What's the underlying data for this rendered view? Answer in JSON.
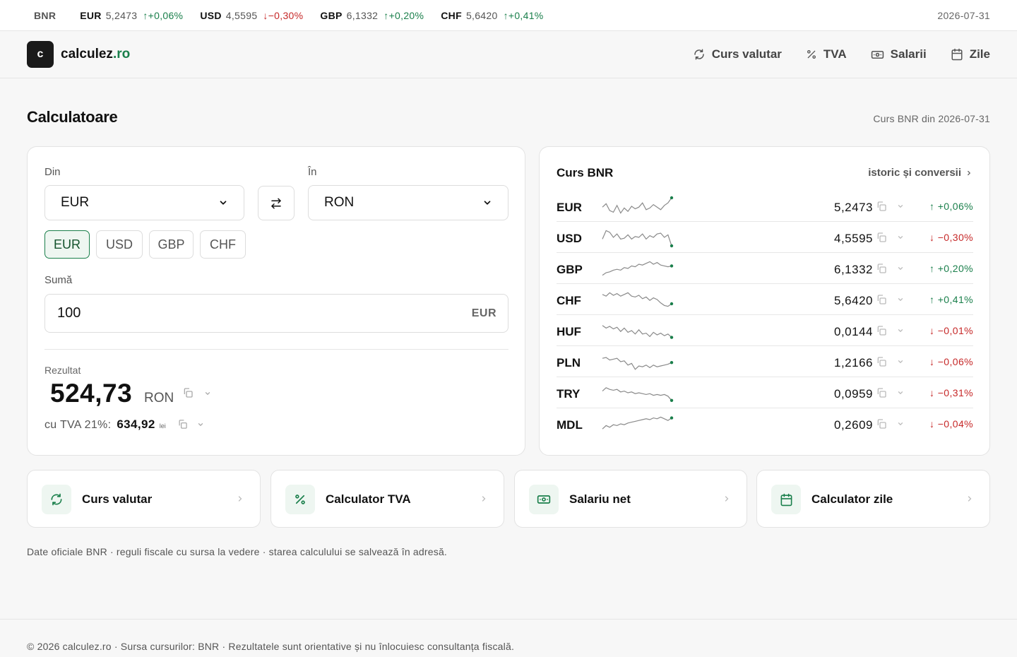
{
  "ticker": {
    "source": "BNR",
    "items": [
      {
        "code": "EUR",
        "value": "5,2473",
        "change": "↑+0,06%",
        "dir": "up"
      },
      {
        "code": "USD",
        "value": "4,5595",
        "change": "↓−0,30%",
        "dir": "down"
      },
      {
        "code": "GBP",
        "value": "6,1332",
        "change": "↑+0,20%",
        "dir": "up"
      },
      {
        "code": "CHF",
        "value": "5,6420",
        "change": "↑+0,41%",
        "dir": "up"
      }
    ],
    "date": "2026-07-31"
  },
  "header": {
    "logo_letter": "c",
    "logo_name": "calculez",
    "logo_tld": ".ro",
    "nav": [
      {
        "label": "Curs valutar",
        "icon": "refresh-icon"
      },
      {
        "label": "TVA",
        "icon": "percent-icon"
      },
      {
        "label": "Salarii",
        "icon": "banknote-icon"
      },
      {
        "label": "Zile",
        "icon": "calendar-icon"
      }
    ]
  },
  "page": {
    "title": "Calculatoare",
    "subtitle": "Curs BNR din 2026-07-31"
  },
  "converter": {
    "from_label": "Din",
    "to_label": "În",
    "from_value": "EUR",
    "to_value": "RON",
    "chips": [
      "EUR",
      "USD",
      "GBP",
      "CHF"
    ],
    "active_chip": "EUR",
    "amount_label": "Sumă",
    "amount_value": "100",
    "amount_unit": "EUR",
    "result_label": "Rezultat",
    "result_value": "524,73",
    "result_currency": "RON",
    "vat_label": "cu TVA 21%:",
    "vat_value": "634,92",
    "vat_unit": "lei"
  },
  "rates": {
    "title": "Curs BNR",
    "link": "istoric și conversii",
    "rows": [
      {
        "code": "EUR",
        "value": "5,2473",
        "change": "↑ +0,06%",
        "dir": "up",
        "trend": [
          0.55,
          0.35,
          0.75,
          0.85,
          0.45,
          0.9,
          0.6,
          0.8,
          0.5,
          0.65,
          0.55,
          0.3,
          0.7,
          0.6,
          0.4,
          0.55,
          0.7,
          0.45,
          0.3,
          0.0
        ]
      },
      {
        "code": "USD",
        "value": "4,5595",
        "change": "↓ −0,30%",
        "dir": "down",
        "trend": [
          0.6,
          0.1,
          0.2,
          0.5,
          0.3,
          0.6,
          0.55,
          0.35,
          0.6,
          0.45,
          0.5,
          0.3,
          0.6,
          0.4,
          0.5,
          0.3,
          0.25,
          0.5,
          0.35,
          1.0
        ]
      },
      {
        "code": "GBP",
        "value": "6,1332",
        "change": "↑ +0,20%",
        "dir": "up",
        "trend": [
          0.9,
          0.75,
          0.7,
          0.6,
          0.55,
          0.6,
          0.45,
          0.5,
          0.35,
          0.4,
          0.25,
          0.3,
          0.2,
          0.1,
          0.25,
          0.15,
          0.3,
          0.35,
          0.4,
          0.35
        ]
      },
      {
        "code": "CHF",
        "value": "5,6420",
        "change": "↑ +0,41%",
        "dir": "up",
        "trend": [
          0.2,
          0.3,
          0.1,
          0.25,
          0.15,
          0.3,
          0.2,
          0.1,
          0.3,
          0.35,
          0.25,
          0.45,
          0.35,
          0.55,
          0.4,
          0.5,
          0.7,
          0.85,
          0.9,
          0.75
        ]
      },
      {
        "code": "HUF",
        "value": "0,0144",
        "change": "↓ −0,01%",
        "dir": "down",
        "trend": [
          0.2,
          0.35,
          0.25,
          0.4,
          0.3,
          0.55,
          0.35,
          0.6,
          0.5,
          0.7,
          0.45,
          0.7,
          0.65,
          0.85,
          0.6,
          0.75,
          0.65,
          0.8,
          0.7,
          0.9
        ]
      },
      {
        "code": "PLN",
        "value": "1,2166",
        "change": "↓ −0,06%",
        "dir": "down",
        "trend": [
          0.3,
          0.25,
          0.4,
          0.35,
          0.3,
          0.5,
          0.45,
          0.7,
          0.6,
          0.95,
          0.75,
          0.8,
          0.7,
          0.85,
          0.7,
          0.8,
          0.75,
          0.7,
          0.65,
          0.55
        ]
      },
      {
        "code": "TRY",
        "value": "0,0959",
        "change": "↓ −0,31%",
        "dir": "down",
        "trend": [
          0.4,
          0.2,
          0.3,
          0.35,
          0.3,
          0.45,
          0.4,
          0.5,
          0.45,
          0.55,
          0.5,
          0.55,
          0.6,
          0.55,
          0.65,
          0.6,
          0.65,
          0.6,
          0.7,
          0.95
        ]
      },
      {
        "code": "MDL",
        "value": "0,2609",
        "change": "↓ −0,04%",
        "dir": "down",
        "trend": [
          0.8,
          0.6,
          0.7,
          0.55,
          0.6,
          0.5,
          0.55,
          0.45,
          0.4,
          0.35,
          0.3,
          0.25,
          0.2,
          0.25,
          0.15,
          0.2,
          0.1,
          0.2,
          0.3,
          0.15
        ]
      }
    ]
  },
  "tools": [
    {
      "label": "Curs valutar",
      "icon": "refresh-icon"
    },
    {
      "label": "Calculator TVA",
      "icon": "percent-icon"
    },
    {
      "label": "Salariu net",
      "icon": "banknote-icon"
    },
    {
      "label": "Calculator zile",
      "icon": "calendar-icon"
    }
  ],
  "note": "Date oficiale BNR · reguli fiscale cu sursa la vedere · starea calculului se salvează în adresă.",
  "footer": "© 2026 calculez.ro · Sursa cursurilor: BNR · Rezultatele sunt orientative și nu înlocuiesc consultanța fiscală.",
  "colors": {
    "accent": "#1a7f4b",
    "up": "#1a7f4b",
    "down": "#c62828",
    "spark": "#8a8a8a"
  }
}
